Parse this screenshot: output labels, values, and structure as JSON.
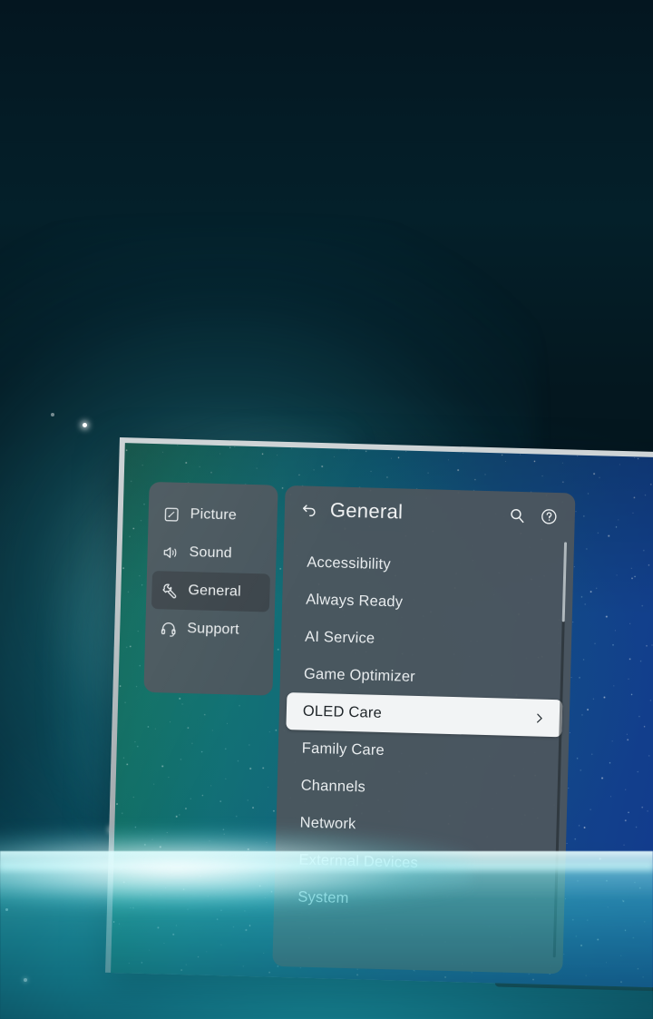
{
  "device": {
    "type": "oled-tv",
    "screen_content": "starfield-wallpaper"
  },
  "settings": {
    "sidebar": {
      "items": [
        {
          "label": "Picture",
          "icon": "picture-icon",
          "active": false
        },
        {
          "label": "Sound",
          "icon": "sound-icon",
          "active": false
        },
        {
          "label": "General",
          "icon": "wrench-icon",
          "active": true
        },
        {
          "label": "Support",
          "icon": "headset-icon",
          "active": false
        }
      ]
    },
    "header": {
      "back_icon": "back-arrow-icon",
      "title": "General",
      "search_icon": "search-icon",
      "help_icon": "help-circle-icon"
    },
    "menu": {
      "items": [
        {
          "label": "Accessibility",
          "selected": false
        },
        {
          "label": "Always Ready",
          "selected": false
        },
        {
          "label": "AI Service",
          "selected": false
        },
        {
          "label": "Game Optimizer",
          "selected": false
        },
        {
          "label": "OLED Care",
          "selected": true
        },
        {
          "label": "Family Care",
          "selected": false
        },
        {
          "label": "Channels",
          "selected": false
        },
        {
          "label": "Network",
          "selected": false
        },
        {
          "label": "Extermal Devices",
          "selected": false
        },
        {
          "label": "System",
          "selected": false
        }
      ],
      "chevron_icon": "chevron-right-icon"
    },
    "scrollbar": {
      "visible": true
    }
  },
  "colors": {
    "panel_bg": "#4c565e",
    "panel_active": "#3c454b",
    "selected_row_bg": "#f2f4f5",
    "selected_row_text": "#20262a",
    "menu_text": "#e8ecee",
    "scene_bg": "#05202a",
    "glow": "#b4ffff"
  }
}
